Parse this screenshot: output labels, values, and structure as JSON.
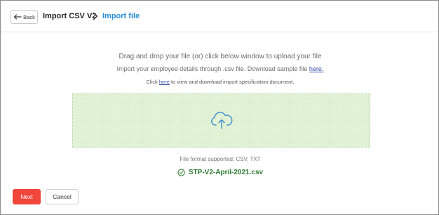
{
  "header": {
    "back_label": "Back",
    "breadcrumb_parent": "Import CSV V2",
    "breadcrumb_current": "Import file"
  },
  "instructions": {
    "line1": "Drag and drop your file (or) click below window to upload your file",
    "line2_prefix": "Import your employee details through .csv file. Download sample file ",
    "line2_link": "here.",
    "line3_prefix": "Click ",
    "line3_link": "here",
    "line3_suffix": " to view and download import specification document."
  },
  "dropzone": {
    "icon": "cloud-upload-icon"
  },
  "formats_text": "File format supported: CSV, TXT",
  "uploaded_file": {
    "name": "STP-V2-April-2021.csv",
    "icon": "check-circle-icon",
    "status_color": "#2e7d32"
  },
  "footer": {
    "next_label": "Next",
    "cancel_label": "Cancel"
  },
  "colors": {
    "accent_link": "#2a8fd6",
    "primary_button": "#f0463c",
    "dropzone_fill": "#e3f3d7"
  }
}
